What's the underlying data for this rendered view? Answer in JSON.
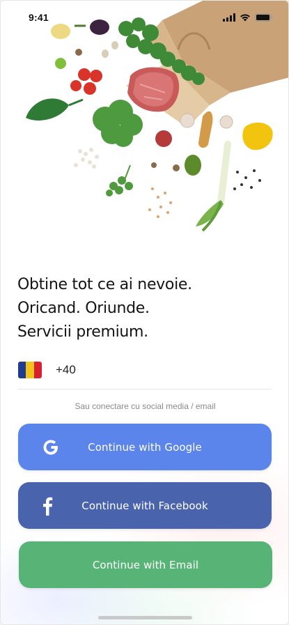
{
  "status_bar": {
    "time": "9:41"
  },
  "hero": {
    "icon": "groceries-illustration"
  },
  "tagline": {
    "line1": "Obtine tot ce ai nevoie.",
    "line2": "Oricand. Oriunde.",
    "line3": "Servicii premium."
  },
  "phone": {
    "country_flag": "romania-flag",
    "flag_colors": [
      "#1f3c8f",
      "#f2c31a",
      "#d8202f"
    ],
    "prefix": "+40"
  },
  "social_note": "Sau conectare cu social media / email",
  "buttons": {
    "google": {
      "label": "Continue with Google",
      "color": "#5b85ea"
    },
    "facebook": {
      "label": "Continue with Facebook",
      "color": "#4a63ad"
    },
    "email": {
      "label": "Continue with Email",
      "color": "#57b476"
    }
  }
}
